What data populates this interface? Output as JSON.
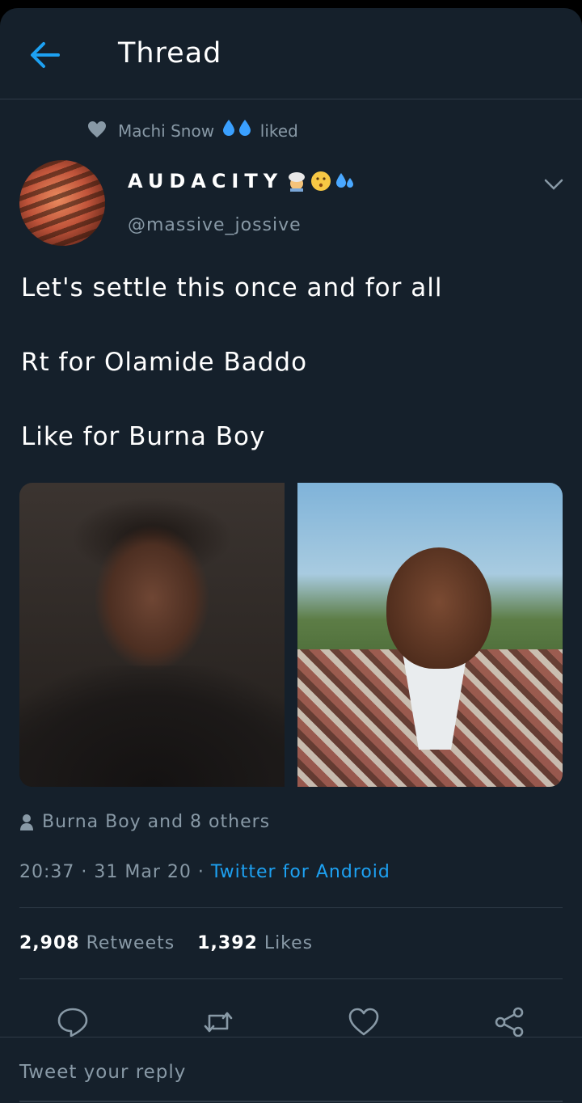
{
  "header": {
    "title": "Thread",
    "back_icon": "arrow-left-icon"
  },
  "social_context": {
    "icon": "heart-icon",
    "user": "Machi Snow",
    "user_emojis": [
      "droplet",
      "droplet"
    ],
    "action": "liked"
  },
  "tweet": {
    "display_name": "AUDACITY",
    "display_name_emojis": [
      "person-wearing-turban",
      "kissing-face",
      "sweat-droplets"
    ],
    "handle": "@massive_jossive",
    "lines": [
      "Let's settle this once and for all",
      "Rt for Olamide Baddo",
      "Like for Burna Boy"
    ],
    "liked_by": "Burna Boy and 8 others",
    "time": "20:37",
    "date": "31 Mar 20",
    "source": "Twitter for Android",
    "retweets_count": "2,908",
    "retweets_label": "Retweets",
    "likes_count": "1,392",
    "likes_label": "Likes"
  },
  "actions": [
    "reply-icon",
    "retweet-icon",
    "like-icon",
    "share-icon"
  ],
  "reply": {
    "placeholder": "Tweet your reply"
  },
  "colors": {
    "background": "#15202b",
    "accent": "#1da1f2",
    "muted": "#8899a6",
    "divider": "#2f3b47"
  }
}
